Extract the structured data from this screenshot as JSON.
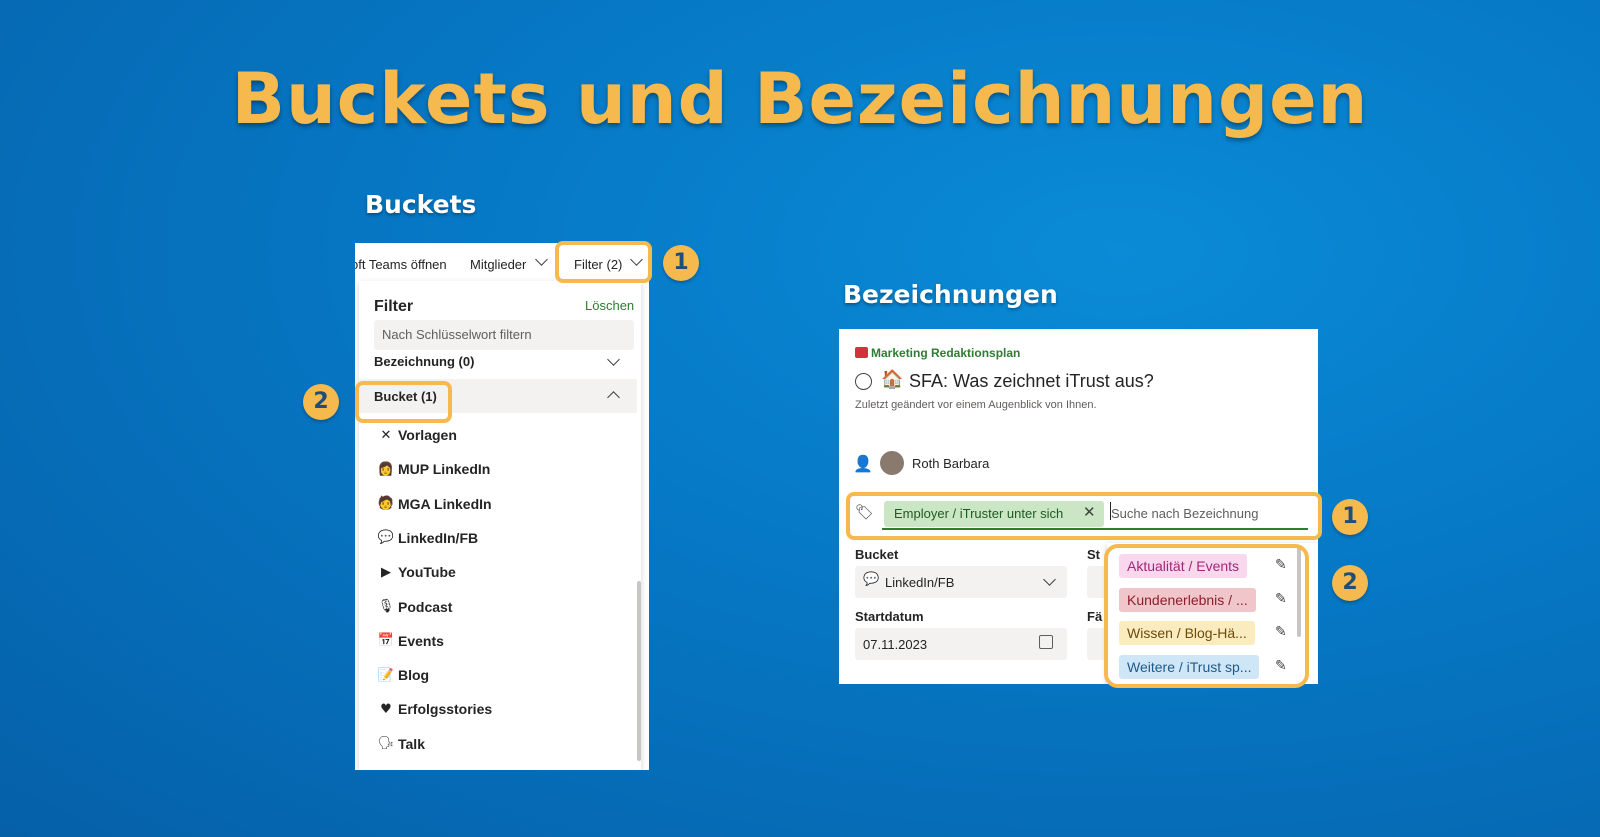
{
  "title": "Buckets und Bezeichnungen",
  "buckets_section": {
    "heading": "Buckets",
    "toolbar": {
      "teams_label": "oft Teams öffnen",
      "members_label": "Mitglieder",
      "filter_label": "Filter (2)"
    },
    "filter_panel": {
      "title": "Filter",
      "clear_label": "Löschen",
      "search_placeholder": "Nach Schlüsselwort filtern",
      "label_group": "Bezeichnung (0)",
      "bucket_group": "Bucket (1)",
      "items": [
        {
          "icon": "x-icon",
          "glyph": "✕",
          "label": "Vorlagen"
        },
        {
          "icon": "person-icon",
          "glyph": "👩",
          "label": "MUP LinkedIn"
        },
        {
          "icon": "person-icon",
          "glyph": "🧑",
          "label": "MGA LinkedIn"
        },
        {
          "icon": "chat-icon",
          "glyph": "💬",
          "label": "LinkedIn/FB"
        },
        {
          "icon": "play-icon",
          "glyph": "▶",
          "label": "YouTube"
        },
        {
          "icon": "mic-icon",
          "glyph": "🎙",
          "label": "Podcast"
        },
        {
          "icon": "calendar-icon",
          "glyph": "📅",
          "label": "Events"
        },
        {
          "icon": "memo-icon",
          "glyph": "📝",
          "label": "Blog"
        },
        {
          "icon": "heart-icon",
          "glyph": "♥",
          "label": "Erfolgsstories"
        },
        {
          "icon": "speaking-icon",
          "glyph": "🗣",
          "label": "Talk"
        }
      ]
    },
    "callouts": [
      "1",
      "2"
    ]
  },
  "labels_section": {
    "heading": "Bezeichnungen",
    "plan_name": "Marketing Redaktionsplan",
    "task_title": "SFA: Was zeichnet iTrust aus?",
    "modified_text": "Zuletzt geändert vor einem Augenblick von Ihnen.",
    "assignee": "Roth Barbara",
    "selected_label": "Employer / iTruster unter sich",
    "search_placeholder": "Suche nach Bezeichnung",
    "bucket_field_label": "Bucket",
    "bucket_value": "LinkedIn/FB",
    "start_field_label": "Startdatum",
    "start_value": "07.11.2023",
    "right_field_label_1": "St",
    "right_field_label_2": "Fä",
    "label_options": [
      {
        "text": "Aktualität / Events",
        "bg": "#f9d7ec",
        "fg": "#a4267a"
      },
      {
        "text": "Kundenerlebnis / ...",
        "bg": "#f1c6cb",
        "fg": "#8a1f2a"
      },
      {
        "text": "Wissen / Blog-Hä...",
        "bg": "#fbecc0",
        "fg": "#6b4a0a"
      },
      {
        "text": "Weitere / iTrust sp...",
        "bg": "#cfe6f7",
        "fg": "#1f5a8a"
      }
    ],
    "callouts": [
      "1",
      "2"
    ]
  },
  "colors": {
    "accent_orange": "#f5b94e",
    "background_blue": "#0677c4",
    "planner_green": "#2e7d32"
  }
}
